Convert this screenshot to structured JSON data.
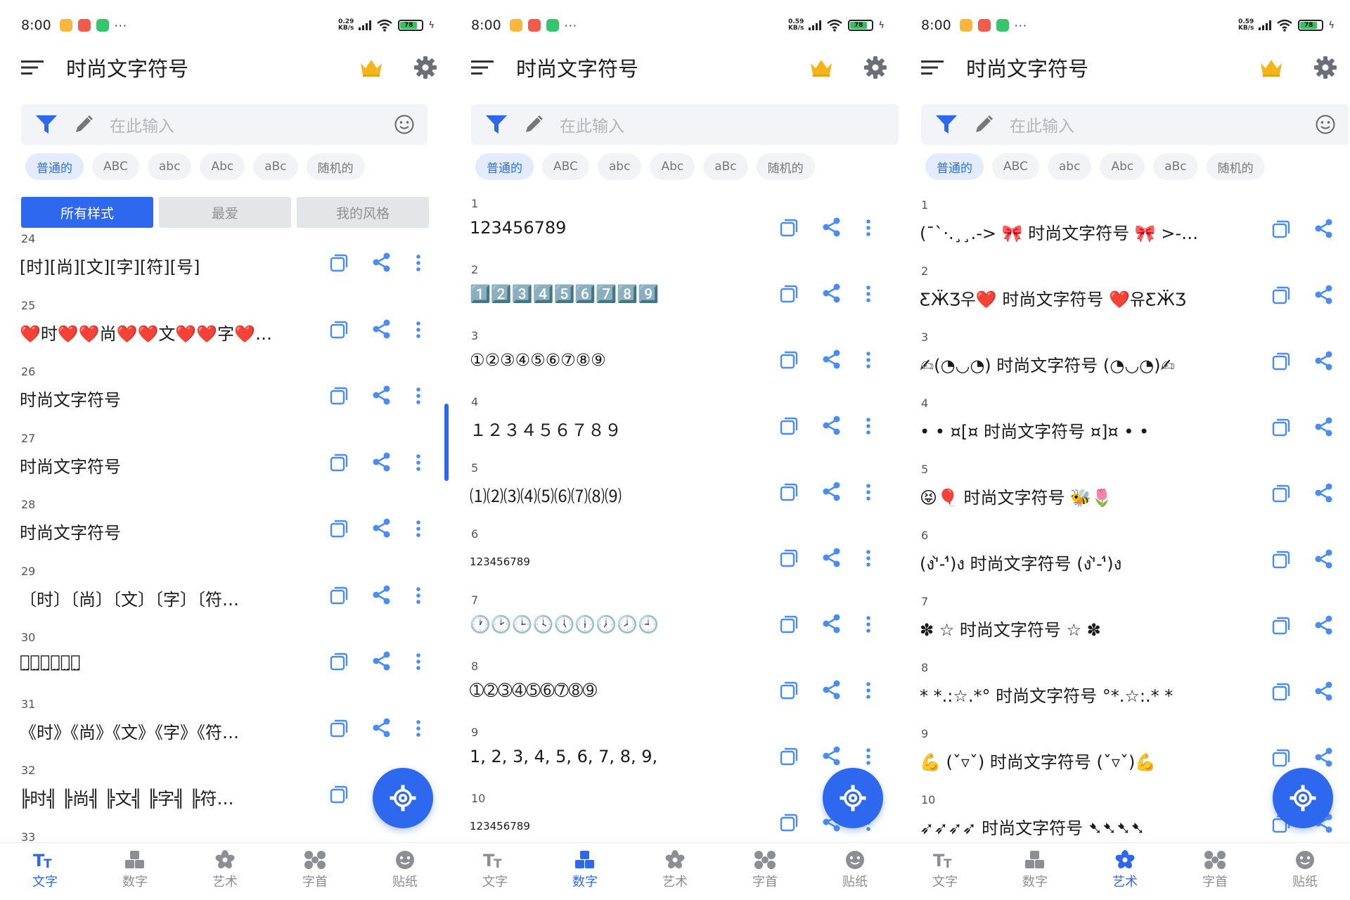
{
  "colors": {
    "accent": "#2e68ee",
    "chip_active_bg": "#e3ecfd",
    "crown": "#f3b51a",
    "gear": "#6b6e77",
    "battery": "#32c45a"
  },
  "app": {
    "title": "时尚文字符号"
  },
  "panels": [
    {
      "status": {
        "time": "8:00",
        "speed_top": "0.29",
        "speed_bottom": "KB/s",
        "battery": "78"
      },
      "search": {
        "placeholder": "在此输入"
      },
      "chips": [
        "普通的",
        "ABC",
        "abc",
        "Abc",
        "aBc",
        "随机的"
      ],
      "segments": [
        "所有样式",
        "最爱",
        "我的风格"
      ],
      "items": [
        {
          "n": "24",
          "t": "[时][尚][文][字][符][号]"
        },
        {
          "n": "25",
          "t": "❤️时❤️❤️尚❤️❤️文❤️❤️字❤️…"
        },
        {
          "n": "26",
          "t": "时尚文字符号"
        },
        {
          "n": "27",
          "t": "时尚文字符号"
        },
        {
          "n": "28",
          "t": "时尚文字符号"
        },
        {
          "n": "29",
          "t": "〔时〕〔尚〕〔文〕〔字〕〔符…"
        },
        {
          "n": "30",
          "t": "时̤尚̤文̤字̤符̤号̤"
        },
        {
          "n": "31",
          "t": "《时》《尚》《文》《字》《符…"
        },
        {
          "n": "32",
          "t": "╠时╣ ╠尚╣ ╠文╣ ╠字╣ ╠符…"
        },
        {
          "n": "33",
          "t": ""
        }
      ]
    },
    {
      "status": {
        "time": "8:00",
        "speed_top": "0.59",
        "speed_bottom": "KB/s",
        "battery": "78"
      },
      "search": {
        "placeholder": "在此输入"
      },
      "chips": [
        "普通的",
        "ABC",
        "abc",
        "Abc",
        "aBc",
        "随机的"
      ],
      "items": [
        {
          "n": "1",
          "t": "123456789"
        },
        {
          "n": "2",
          "t": "1️⃣2️⃣3️⃣4️⃣5️⃣6️⃣7️⃣8️⃣9️⃣"
        },
        {
          "n": "3",
          "t": "①②③④⑤⑥⑦⑧⑨"
        },
        {
          "n": "4",
          "t": "１２３４５６７８９"
        },
        {
          "n": "5",
          "t": "⑴⑵⑶⑷⑸⑹⑺⑻⑼"
        },
        {
          "n": "6",
          "t": "123456789"
        },
        {
          "n": "7",
          "t": "🕐🕑🕒🕓🕔🕕🕖🕗🕘"
        },
        {
          "n": "8",
          "t": "➀➁➂➃➄➅➆➇➈"
        },
        {
          "n": "9",
          "t": "1, 2, 3, 4, 5, 6, 7, 8, 9,"
        },
        {
          "n": "10",
          "t": "123456789"
        }
      ]
    },
    {
      "status": {
        "time": "8:00",
        "speed_top": "0.59",
        "speed_bottom": "KB/s",
        "battery": "78"
      },
      "search": {
        "placeholder": "在此输入"
      },
      "chips": [
        "普通的",
        "ABC",
        "abc",
        "Abc",
        "aBc",
        "随机的"
      ],
      "items": [
        {
          "n": "1",
          "t": "(¯`·.¸¸.-> 🎀 时尚文字符号 🎀 >-…"
        },
        {
          "n": "2",
          "t": "ƸӜƷ우❤️ 时尚文字符号 ❤️유ƸӜƷ"
        },
        {
          "n": "3",
          "t": "✍(◔◡◔) 时尚文字符号 (◔◡◔)✍"
        },
        {
          "n": "4",
          "t": "• • ¤[¤ 时尚文字符号 ¤]¤ • •"
        },
        {
          "n": "5",
          "t": "😝🎈 时尚文字符号 🐝🌷"
        },
        {
          "n": "6",
          "t": "(ง'̀-'́)ง 时尚文字符号 (ง'̀-'́)ง"
        },
        {
          "n": "7",
          "t": "✽ ☆ 时尚文字符号 ☆ ✽"
        },
        {
          "n": "8",
          "t": "* *.:☆.*° 时尚文字符号 °*.☆:.* *"
        },
        {
          "n": "9",
          "t": "💪 (ˇ▿ˇ) 时尚文字符号 (ˇ▿ˇ)💪"
        },
        {
          "n": "10",
          "t": "➶➶➶➶ 时尚文字符号 ➷➷➷➷"
        }
      ]
    }
  ],
  "nav": [
    "文字",
    "数字",
    "艺术",
    "字首",
    "贴纸"
  ]
}
